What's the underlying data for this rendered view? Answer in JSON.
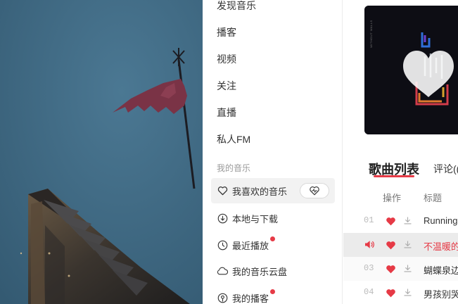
{
  "sidebar": {
    "nav": [
      {
        "label": "发现音乐",
        "name": "nav-discover-music"
      },
      {
        "label": "播客",
        "name": "nav-podcast"
      },
      {
        "label": "视频",
        "name": "nav-video"
      },
      {
        "label": "关注",
        "name": "nav-follow"
      },
      {
        "label": "直播",
        "name": "nav-live"
      },
      {
        "label": "私人FM",
        "name": "nav-private-fm"
      }
    ],
    "my_music_label": "我的音乐",
    "my_music": [
      {
        "label": "我喜欢的音乐",
        "icon": "heart-outline-icon",
        "active": true,
        "dot": false
      },
      {
        "label": "本地与下载",
        "icon": "download-circle-icon",
        "active": false,
        "dot": false
      },
      {
        "label": "最近播放",
        "icon": "clock-icon",
        "active": false,
        "dot": true
      },
      {
        "label": "我的音乐云盘",
        "icon": "cloud-icon",
        "active": false,
        "dot": false
      },
      {
        "label": "我的播客",
        "icon": "podcast-icon",
        "active": false,
        "dot": true
      }
    ],
    "heart_mode_icon": "heart-mode-icon"
  },
  "main": {
    "tabs": {
      "active": "歌曲列表",
      "other": "评论(("
    },
    "columns": {
      "action": "操作",
      "title": "标题"
    },
    "songs": [
      {
        "num": "01",
        "title": "Running",
        "liked": true,
        "playing": false
      },
      {
        "num": "02",
        "title": "不温暖的",
        "liked": true,
        "playing": true
      },
      {
        "num": "03",
        "title": "蝴蝶泉边",
        "liked": true,
        "playing": false
      },
      {
        "num": "04",
        "title": "男孩别哭",
        "liked": true,
        "playing": false
      }
    ]
  },
  "colors": {
    "accent": "#e63a46",
    "highlight_row": "#ebebeb",
    "art_background": "#3f6a84"
  }
}
